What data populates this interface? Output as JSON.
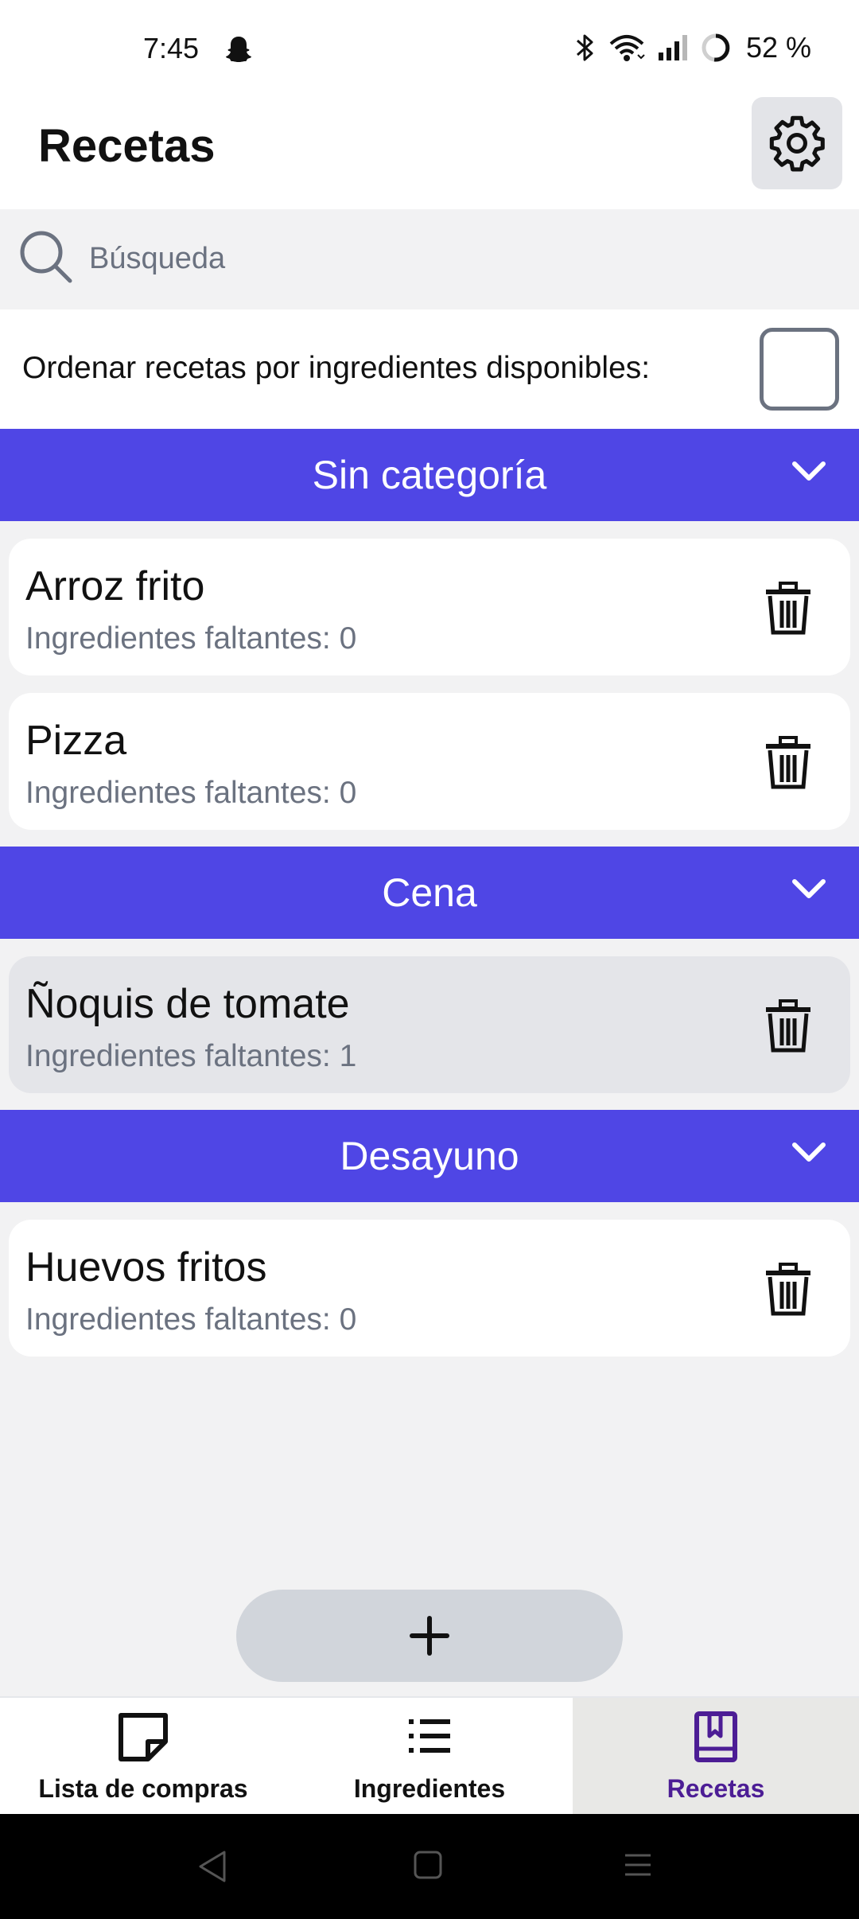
{
  "status_bar": {
    "time": "7:45",
    "battery": "52 %",
    "icons": [
      "snapchat-icon",
      "bluetooth-icon",
      "wifi-icon",
      "signal-icon",
      "battery-icon"
    ]
  },
  "header": {
    "title": "Recetas",
    "settings_icon": "gear-icon"
  },
  "search": {
    "placeholder": "Búsqueda",
    "value": ""
  },
  "sort": {
    "label": "Ordenar recetas por ingredientes disponibles:",
    "checked": false
  },
  "categories": [
    {
      "title": "Sin categoría",
      "recipes": [
        {
          "name": "Arroz frito",
          "missing": "Ingredientes faltantes: 0"
        },
        {
          "name": "Pizza",
          "missing": "Ingredientes faltantes: 0"
        }
      ]
    },
    {
      "title": "Cena",
      "recipes": [
        {
          "name": "Ñoquis de tomate",
          "missing": "Ingredientes faltantes: 1"
        }
      ]
    },
    {
      "title": "Desayuno",
      "recipes": [
        {
          "name": "Huevos fritos",
          "missing": "Ingredientes faltantes: 0"
        }
      ]
    }
  ],
  "add_button": {
    "label": "+"
  },
  "bottom_nav": {
    "items": [
      {
        "label": "Lista de compras",
        "icon": "note-icon"
      },
      {
        "label": "Ingredientes",
        "icon": "list-icon"
      },
      {
        "label": "Recetas",
        "icon": "book-icon"
      }
    ],
    "active": "Recetas"
  },
  "colors": {
    "accent": "#4f46e5",
    "active_nav_text": "#4c1d95",
    "muted_text": "#6b7280"
  }
}
